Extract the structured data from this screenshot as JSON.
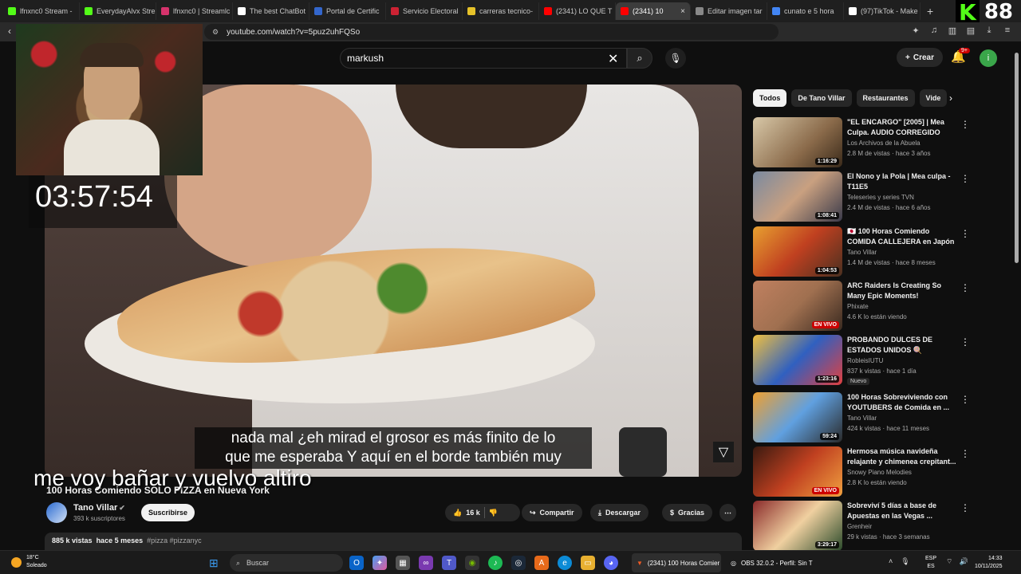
{
  "browser": {
    "tabs": [
      {
        "label": "lfnxnc0 Stream - ",
        "color": "#53fc18"
      },
      {
        "label": "EverydayAlvx Stre",
        "color": "#53fc18"
      },
      {
        "label": "lfnxnc0 | Streamlc",
        "color": "#d6336c"
      },
      {
        "label": "The best ChatBot",
        "color": "#ffffff"
      },
      {
        "label": "Portal de Certific",
        "color": "#3366cc"
      },
      {
        "label": "Servicio Electoral",
        "color": "#cc2233"
      },
      {
        "label": "carreras tecnico-",
        "color": "#e6c229"
      },
      {
        "label": "(2341) LO QUE T",
        "color": "#ff0000"
      },
      {
        "label": "(2341) 10",
        "color": "#ff0000",
        "active": true
      },
      {
        "label": "Editar imagen tar",
        "color": "#888888"
      },
      {
        "label": "cunato e 5 hora",
        "color": "#4285f4"
      },
      {
        "label": "(97)TikTok - Make",
        "color": "#ffffff"
      }
    ],
    "active_tab_close": "×",
    "new_tab": "+",
    "url": "youtube.com/watch?v=5puz2uhFQSo"
  },
  "kick_counter": {
    "logo": "K",
    "value": "88"
  },
  "overlay": {
    "timer": "03:57:54",
    "streamer_caption": "me voy bañar y vuelvo altiro"
  },
  "youtube": {
    "search_value": "markush",
    "create_label": "Crear",
    "notifications_badge": "9+",
    "user_initial": "i"
  },
  "video": {
    "caption_line1": "nada mal ¿eh mirad el grosor es más finito de lo",
    "caption_line2": "que me esperaba Y aquí en el borde también muy",
    "title": "100 Horas Comiendo SOLO PIZZA en Nueva York",
    "channel_name": "Tano Villar",
    "channel_subs": "393 k suscriptores",
    "subscribe_label": "Suscribirse",
    "likes": "16 k",
    "share_label": "Compartir",
    "download_label": "Descargar",
    "thanks_label": "Gracias",
    "views": "885 k vistas",
    "age": "hace 5 meses",
    "tags": "#pizza #pizzanyc"
  },
  "sidebar": {
    "chips": [
      "Todos",
      "De Tano Villar",
      "Restaurantes",
      "Vide"
    ],
    "recommendations": [
      {
        "title": "\"EL ENCARGO\" [2005] | Mea Culpa. AUDIO CORREGIDO",
        "channel": "Los Archivos de la Abuela",
        "meta": "2.8 M de vistas · hace 3 años",
        "duration": "1:16:29",
        "thumb": "linear-gradient(135deg,#d8c8a8,#8a6a4a 60%,#3a2a1a)"
      },
      {
        "title": "El Nono y la Pola | Mea culpa - T11E5",
        "channel": "Teleseries y series TVN",
        "meta": "2.4 M de vistas · hace 6 años",
        "duration": "1:08:41",
        "thumb": "linear-gradient(135deg,#7a8aa0,#c9a080 50%,#3a3a4a)"
      },
      {
        "title": "🇯🇵 100 Horas Comiendo COMIDA CALLEJERA en Japón",
        "channel": "Tano Villar",
        "meta": "1.4 M de vistas · hace 8 meses",
        "duration": "1:04:53",
        "thumb": "linear-gradient(135deg,#e8a030,#c04020 50%,#4a3020)"
      },
      {
        "title": "ARC Raiders Is Creating So Many Epic Moments!",
        "channel": "Phixate",
        "meta": "4.6 K lo están viendo",
        "live": "EN VIVO",
        "thumb": "linear-gradient(135deg,#c08060,#a07050 50%,#3a2a20)"
      },
      {
        "title": "PROBANDO DULCES DE ESTADOS UNIDOS 🍭",
        "channel": "RobleisIUTU",
        "meta": "837 k vistas · hace 1 día",
        "duration": "1:23:16",
        "badge": "Nuevo",
        "thumb": "linear-gradient(135deg,#f0c040,#3060c0 50%,#e04040)"
      },
      {
        "title": "100 Horas Sobreviviendo con YOUTUBERS de Comida en ...",
        "channel": "Tano Villar",
        "meta": "424 k vistas · hace 11 meses",
        "duration": "59:24",
        "thumb": "linear-gradient(135deg,#f0a030,#60a0e0 50%,#2a2a2a)"
      },
      {
        "title": "Hermosa música navideña relajante y chimenea crepitant...",
        "channel": "Snowy Piano Melodies",
        "meta": "2.8 K lo están viendo",
        "live": "EN VIVO",
        "thumb": "linear-gradient(135deg,#3a1a10,#c04020 50%,#f0a040)"
      },
      {
        "title": "Sobreviví 5 días a base de Apuestas en las Vegas ...",
        "channel": "Grenheir",
        "meta": "29 k vistas · hace 3 semanas",
        "duration": "3:29:17",
        "thumb": "linear-gradient(135deg,#8a2a2a,#f0d0a0 50%,#2a4a2a)"
      }
    ]
  },
  "taskbar": {
    "temp": "18°C",
    "weather": "Soleado",
    "search": "Buscar",
    "window1": "(2341) 100 Horas Comier",
    "window2": "OBS 32.0.2 - Perfil: Sin T",
    "lang1": "ESP",
    "lang2": "ES",
    "time": "14:33",
    "date": "10/11/2025"
  }
}
